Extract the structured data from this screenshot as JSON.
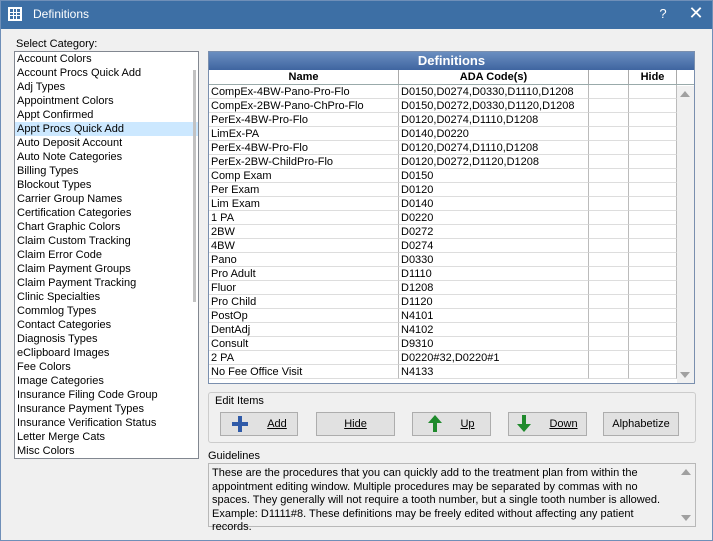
{
  "window": {
    "title": "Definitions",
    "help": "?",
    "close": "✕"
  },
  "categories": {
    "label": "Select Category:",
    "selected_index": 5,
    "items": [
      "Account Colors",
      "Account Procs Quick Add",
      "Adj Types",
      "Appointment Colors",
      "Appt Confirmed",
      "Appt Procs Quick Add",
      "Auto Deposit Account",
      "Auto Note Categories",
      "Billing Types",
      "Blockout Types",
      "Carrier Group Names",
      "Certification Categories",
      "Chart Graphic Colors",
      "Claim Custom Tracking",
      "Claim Error Code",
      "Claim Payment Groups",
      "Claim Payment Tracking",
      "Clinic Specialties",
      "Commlog Types",
      "Contact Categories",
      "Diagnosis Types",
      "eClipboard Images",
      "Fee Colors",
      "Image Categories",
      "Insurance Filing Code Group",
      "Insurance Payment Types",
      "Insurance Verification Status",
      "Letter Merge Cats",
      "Misc Colors"
    ]
  },
  "definitions": {
    "title": "Definitions",
    "columns": {
      "name": "Name",
      "code": "ADA Code(s)",
      "blank": "",
      "hide": "Hide"
    },
    "rows": [
      {
        "name": "CompEx-4BW-Pano-Pro-Flo",
        "code": "D0150,D0274,D0330,D1110,D1208"
      },
      {
        "name": "CompEx-2BW-Pano-ChPro-Flo",
        "code": "D0150,D0272,D0330,D1120,D1208"
      },
      {
        "name": "PerEx-4BW-Pro-Flo",
        "code": "D0120,D0274,D1110,D1208"
      },
      {
        "name": "LimEx-PA",
        "code": "D0140,D0220"
      },
      {
        "name": "PerEx-4BW-Pro-Flo",
        "code": "D0120,D0274,D1110,D1208"
      },
      {
        "name": "PerEx-2BW-ChildPro-Flo",
        "code": "D0120,D0272,D1120,D1208"
      },
      {
        "name": "Comp Exam",
        "code": "D0150"
      },
      {
        "name": "Per Exam",
        "code": "D0120"
      },
      {
        "name": "Lim Exam",
        "code": "D0140"
      },
      {
        "name": "1 PA",
        "code": "D0220"
      },
      {
        "name": "2BW",
        "code": "D0272"
      },
      {
        "name": "4BW",
        "code": "D0274"
      },
      {
        "name": "Pano",
        "code": "D0330"
      },
      {
        "name": "Pro Adult",
        "code": "D1110"
      },
      {
        "name": "Fluor",
        "code": "D1208"
      },
      {
        "name": "Pro Child",
        "code": "D1120"
      },
      {
        "name": "PostOp",
        "code": "N4101"
      },
      {
        "name": "DentAdj",
        "code": "N4102"
      },
      {
        "name": "Consult",
        "code": "D9310"
      },
      {
        "name": "2 PA",
        "code": "D0220#32,D0220#1"
      },
      {
        "name": "No Fee Office Visit",
        "code": "N4133"
      }
    ]
  },
  "edit_items": {
    "label": "Edit Items",
    "add": "Add",
    "hide": "Hide",
    "up": "Up",
    "down": "Down",
    "alphabetize": "Alphabetize"
  },
  "guidelines": {
    "label": "Guidelines",
    "text": "These are the procedures that you can quickly add to the treatment plan from within the appointment editing window. Multiple procedures may be separated by commas with no spaces. They generally will not require a tooth number, but a single tooth number is allowed. Example: D1111#8. These definitions may be freely edited without affecting any patient records."
  },
  "colors": {
    "titlebar": "#3d6fa5",
    "selection": "#cce8ff",
    "grid_header": "#4a72ad",
    "arrow_green": "#1f8a2c",
    "plus_blue": "#2f5aa8"
  }
}
